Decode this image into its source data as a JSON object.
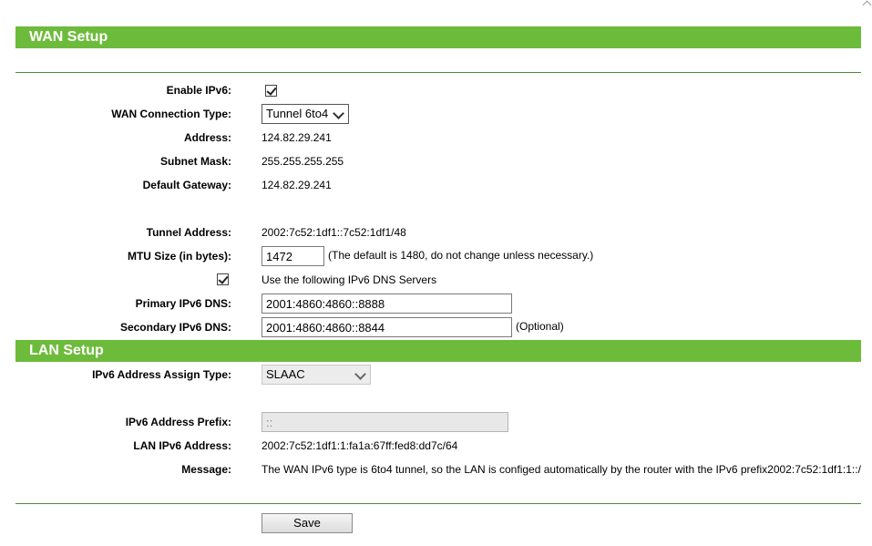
{
  "wan": {
    "title": "WAN Setup",
    "enable_ipv6_label": "Enable IPv6:",
    "enable_ipv6_checked": true,
    "connection_type_label": "WAN Connection Type:",
    "connection_type_value": "Tunnel 6to4",
    "address_label": "Address:",
    "address_value": "124.82.29.241",
    "subnet_label": "Subnet Mask:",
    "subnet_value": "255.255.255.255",
    "gateway_label": "Default Gateway:",
    "gateway_value": "124.82.29.241",
    "tunnel_label": "Tunnel Address:",
    "tunnel_value": "2002:7c52:1df1::7c52:1df1/48",
    "mtu_label": "MTU Size (in bytes):",
    "mtu_value": "1472",
    "mtu_note": "(The default is 1480, do not change unless necessary.)",
    "dns_checkbox_checked": true,
    "dns_checkbox_label": "Use the following IPv6 DNS Servers",
    "primary_dns_label": "Primary IPv6 DNS:",
    "primary_dns_value": "2001:4860:4860::8888",
    "secondary_dns_label": "Secondary IPv6 DNS:",
    "secondary_dns_value": "2001:4860:4860::8844",
    "secondary_dns_note": "(Optional)"
  },
  "lan": {
    "title": "LAN Setup",
    "assign_type_label": "IPv6 Address Assign Type:",
    "assign_type_value": "SLAAC",
    "prefix_label": "IPv6 Address Prefix:",
    "prefix_value": "::",
    "lan_address_label": "LAN IPv6 Address:",
    "lan_address_value": "2002:7c52:1df1:1:fa1a:67ff:fed8:dd7c/64",
    "message_label": "Message:",
    "message_value": "The WAN IPv6 type is 6to4 tunnel, so the LAN is configed automatically by the router with the IPv6 prefix2002:7c52:1df1:1::/"
  },
  "save_label": "Save",
  "icons": {
    "checkbox": "checkmark-icon",
    "dropdown": "chevron-down-icon",
    "scroll": "scroll-up-arrow-icon"
  },
  "colors": {
    "section_bar": "#6dbb3b",
    "divider": "#4e8a3a"
  }
}
